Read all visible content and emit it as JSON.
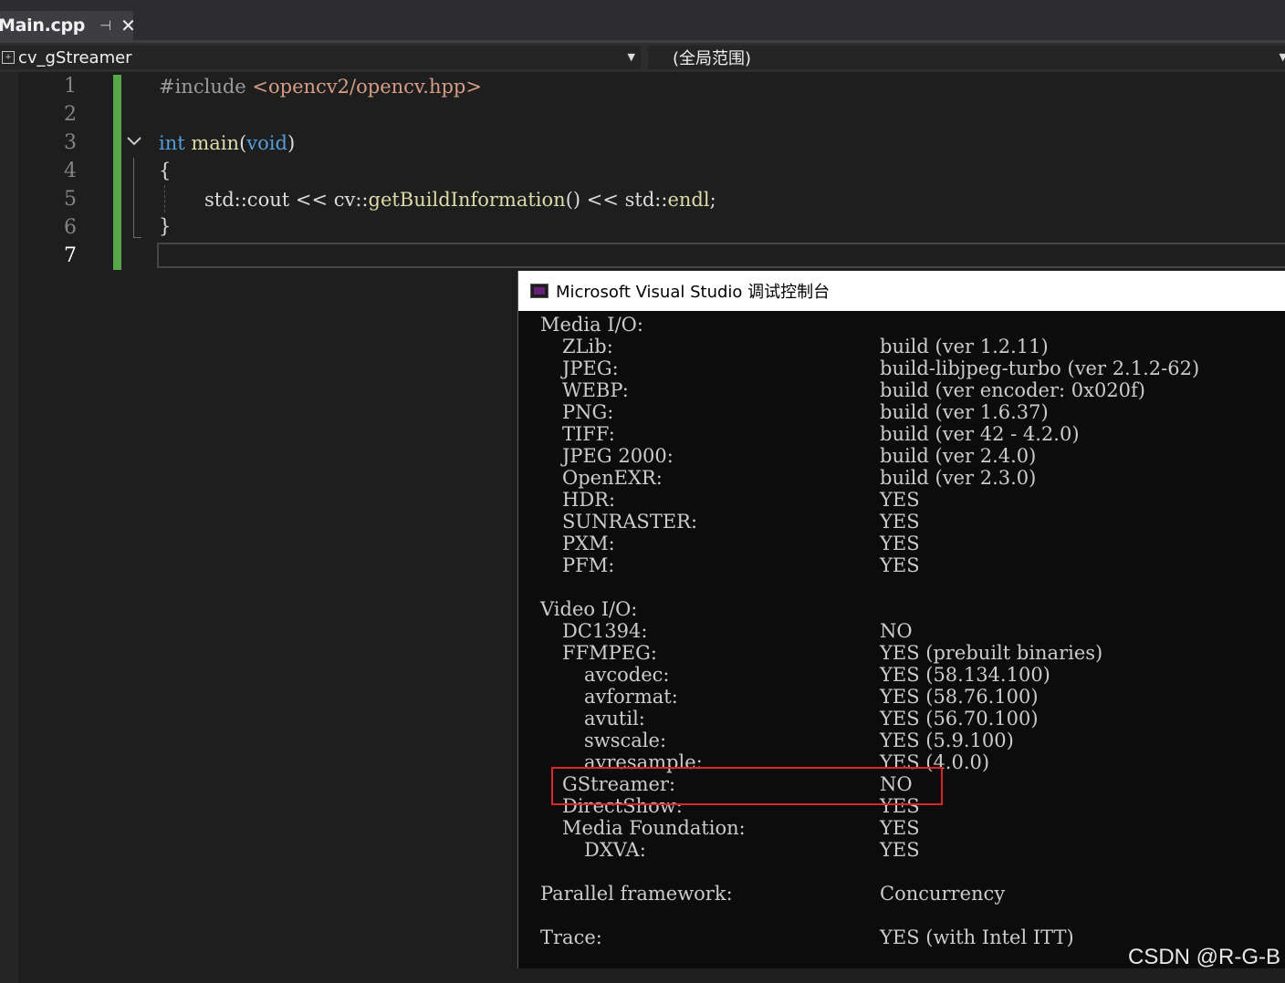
{
  "tab": {
    "filename": "Main.cpp",
    "pin_glyph": "⊣",
    "close_glyph": "✕"
  },
  "nav": {
    "project": "cv_gStreamer",
    "scope": "(全局范围)"
  },
  "editor": {
    "line_numbers": [
      "1",
      "2",
      "3",
      "4",
      "5",
      "6",
      "7"
    ],
    "current_line": "7",
    "code": {
      "line1_directive": "#include",
      "line1_header": "<opencv2/opencv.hpp>",
      "line3_type": "int",
      "line3_name": "main",
      "line3_open": "(",
      "line3_param": "void",
      "line3_close": ")",
      "line4": "{",
      "line5_a": "std::cout << cv::",
      "line5_fn": "getBuildInformation",
      "line5_b": "() << std::",
      "line5_endl": "endl",
      "line5_c": ";",
      "line6": "}"
    }
  },
  "console": {
    "title": "Microsoft Visual Studio 调试控制台",
    "sections": {
      "media_heading": "Media I/O:",
      "video_heading": "Video I/O:"
    },
    "media": [
      {
        "key": "ZLib:",
        "value": "build (ver 1.2.11)"
      },
      {
        "key": "JPEG:",
        "value": "build-libjpeg-turbo (ver 2.1.2-62)"
      },
      {
        "key": "WEBP:",
        "value": "build (ver encoder: 0x020f)"
      },
      {
        "key": "PNG:",
        "value": "build (ver 1.6.37)"
      },
      {
        "key": "TIFF:",
        "value": "build (ver 42 - 4.2.0)"
      },
      {
        "key": "JPEG 2000:",
        "value": "build (ver 2.4.0)"
      },
      {
        "key": "OpenEXR:",
        "value": "build (ver 2.3.0)"
      },
      {
        "key": "HDR:",
        "value": "YES"
      },
      {
        "key": "SUNRASTER:",
        "value": "YES"
      },
      {
        "key": "PXM:",
        "value": "YES"
      },
      {
        "key": "PFM:",
        "value": "YES"
      }
    ],
    "video": [
      {
        "key": "DC1394:",
        "value": "NO"
      },
      {
        "key": "FFMPEG:",
        "value": "YES (prebuilt binaries)"
      },
      {
        "key": "avcodec:",
        "value": "YES (58.134.100)"
      },
      {
        "key": "avformat:",
        "value": "YES (58.76.100)"
      },
      {
        "key": "avutil:",
        "value": "YES (56.70.100)"
      },
      {
        "key": "swscale:",
        "value": "YES (5.9.100)"
      },
      {
        "key": "avresample:",
        "value": "YES (4.0.0)"
      },
      {
        "key": "GStreamer:",
        "value": "NO"
      },
      {
        "key": "DirectShow:",
        "value": "YES"
      },
      {
        "key": "Media Foundation:",
        "value": "YES"
      },
      {
        "key": "DXVA:",
        "value": "YES"
      }
    ],
    "parallel": {
      "key": "Parallel framework:",
      "value": "Concurrency"
    },
    "trace": {
      "key": "Trace:",
      "value": "YES (with Intel ITT)"
    }
  },
  "watermark": "CSDN @R-G-B",
  "colors": {
    "highlight": "#e0252a",
    "change_bar": "#57a64a",
    "keyword": "#569cd6",
    "string": "#d69d85",
    "function": "#dcdcaa"
  }
}
